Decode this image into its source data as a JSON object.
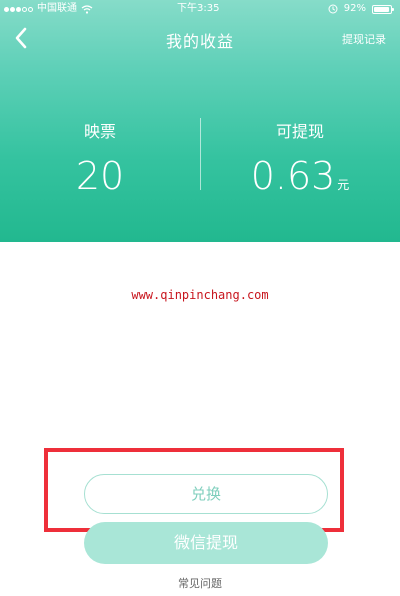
{
  "status_bar": {
    "carrier": "中国联通",
    "time": "下午3:35",
    "battery_text": "92%",
    "battery_level": 0.92,
    "wifi_icon": "wifi-icon",
    "alarm_icon": "alarm-icon"
  },
  "nav": {
    "title": "我的收益",
    "right_label": "提现记录",
    "back_icon": "chevron-left-icon"
  },
  "stats": {
    "tickets_label": "映票",
    "tickets_value": "20",
    "withdrawable_label": "可提现",
    "withdrawable_value": "0.63",
    "withdrawable_unit": "元"
  },
  "watermark": "www.qinpinchang.com",
  "actions": {
    "exchange_label": "兑换",
    "wechat_withdraw_label": "微信提现",
    "faq_label": "常见问题"
  },
  "colors": {
    "header_top": "#86dcc9",
    "header_bottom": "#22b88f",
    "highlight_border": "#ee2f3a",
    "watermark": "#c8161e",
    "button_outline": "#a6e0d2",
    "button_fill": "#a9e6d7"
  }
}
